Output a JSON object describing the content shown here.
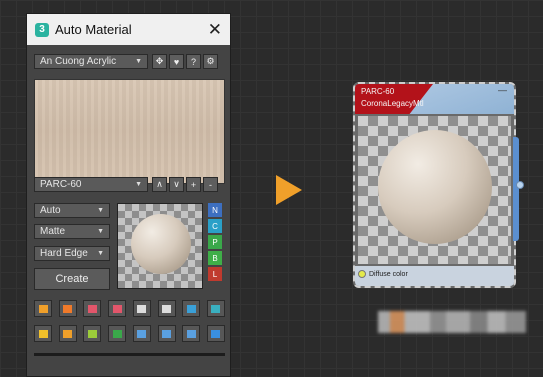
{
  "window": {
    "title": "Auto Material",
    "close_glyph": "✕",
    "icon_letter": "3"
  },
  "library": {
    "selected": "An Cuong Acrylic"
  },
  "library_buttons": [
    "✥",
    "♥",
    "?",
    "⚙"
  ],
  "material": {
    "selected": "PARC-60"
  },
  "nav_buttons": [
    "∧",
    "∨",
    "+",
    "-"
  ],
  "mapping": {
    "selected": "Auto"
  },
  "finish": {
    "selected": "Matte"
  },
  "edge": {
    "selected": "Hard Edge"
  },
  "create_label": "Create",
  "channel_buttons": [
    {
      "label": "N",
      "color": "#3d6fc0"
    },
    {
      "label": "C",
      "color": "#2aa0c8"
    },
    {
      "label": "P",
      "color": "#3aa84a"
    },
    {
      "label": "B",
      "color": "#3fae48"
    },
    {
      "label": "L",
      "color": "#c03a2e"
    }
  ],
  "tool_row_1": [
    {
      "icon": "brush-icon",
      "color": "#f0a02a"
    },
    {
      "icon": "align-left-icon",
      "color": "#f07a2a"
    },
    {
      "icon": "align-right-icon",
      "color": "#e2566b"
    },
    {
      "icon": "move-icon",
      "color": "#e2566b"
    },
    {
      "icon": "columns-icon",
      "color": "#dddddd"
    },
    {
      "icon": "target-icon",
      "color": "#dddddd"
    },
    {
      "icon": "grid-icon",
      "color": "#3aa0d8"
    },
    {
      "icon": "export-icon",
      "color": "#3ab0c0"
    }
  ],
  "tool_row_2": [
    {
      "icon": "crop-icon",
      "color": "#f0c02a"
    },
    {
      "icon": "fill-icon",
      "color": "#f0a02a"
    },
    {
      "icon": "tile-icon",
      "color": "#9ccc3a"
    },
    {
      "icon": "square-icon",
      "color": "#3aa84a"
    },
    {
      "icon": "split-h-icon",
      "color": "#5aa0e0"
    },
    {
      "icon": "split-v-icon",
      "color": "#5aa0e0"
    },
    {
      "icon": "rotate-icon",
      "color": "#5aa0e0"
    },
    {
      "icon": "corner-icon",
      "color": "#3a90e0"
    }
  ],
  "node": {
    "name": "PARC-60",
    "class_name": "CoronaLegacyMtl",
    "minimize_glyph": "—",
    "input_label": "Diffuse color"
  },
  "colors": {
    "accent_arrow": "#f0a02a",
    "node_header_red": "#b3121a"
  }
}
